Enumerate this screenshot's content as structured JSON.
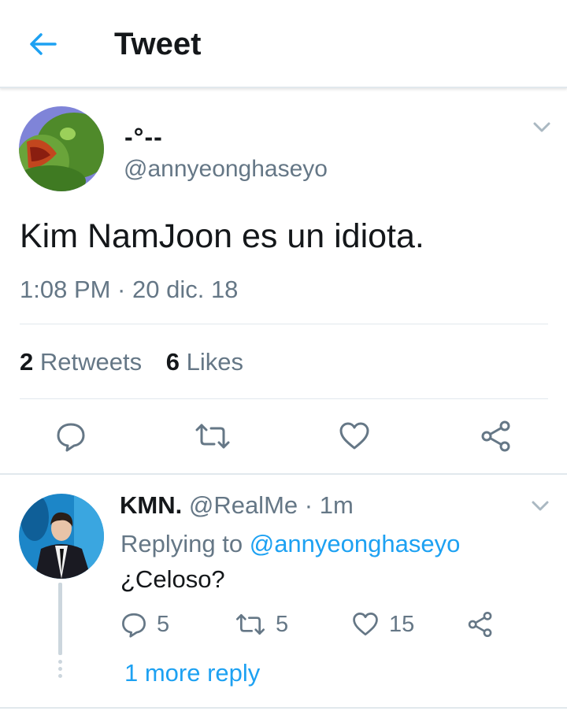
{
  "header": {
    "title": "Tweet",
    "back_icon": "arrow-left-icon"
  },
  "tweet": {
    "display_name": "-°--",
    "handle": "@annyeonghaseyo",
    "text": "Kim NamJoon es un idiota.",
    "timestamp": "1:08 PM · 20 dic. 18",
    "retweet_count": "2",
    "retweet_label": "Retweets",
    "like_count": "6",
    "like_label": "Likes",
    "actions": [
      "reply-icon",
      "retweet-icon",
      "heart-icon",
      "share-icon"
    ]
  },
  "reply": {
    "name": "KMN.",
    "handle": "@RealMe",
    "separator": "·",
    "time": "1m",
    "replying_prefix": "Replying to",
    "replying_handle": "@annyeonghaseyo",
    "text": "¿Celoso?",
    "reply_count": "5",
    "retweet_count": "5",
    "like_count": "15",
    "more_replies": "1 more reply"
  },
  "colors": {
    "accent": "#1da1f2",
    "secondary_text": "#657786",
    "primary_text": "#14171a",
    "divider": "#e1e8ed"
  }
}
